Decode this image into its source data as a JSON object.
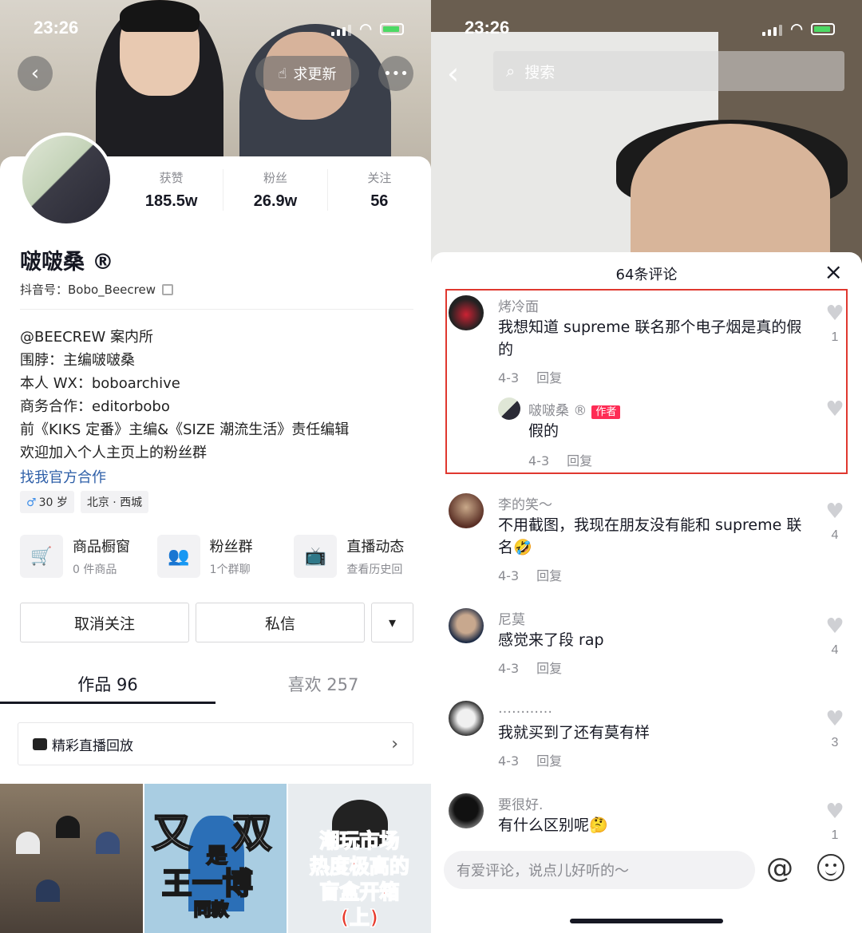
{
  "left": {
    "status": {
      "time": "23:26"
    },
    "header": {
      "request_update_label": "求更新"
    },
    "stats": [
      {
        "label": "获赞",
        "value": "185.5w"
      },
      {
        "label": "粉丝",
        "value": "26.9w"
      },
      {
        "label": "关注",
        "value": "56"
      }
    ],
    "profile": {
      "name": "啵啵桑 ®",
      "id_label": "抖音号：Bobo_Beecrew",
      "bio": [
        "@BEECREW 案内所",
        "围脖：主编啵啵桑",
        "本人 WX：boboarchive",
        "商务合作：editorbobo",
        "前《KIKS 定番》主编&《SIZE 潮流生活》责任编辑",
        "欢迎加入个人主页上的粉丝群"
      ],
      "official_link": "找我官方合作",
      "tags": {
        "age": "30 岁",
        "location": "北京 · 西城",
        "gender_symbol": "♂"
      }
    },
    "services": [
      {
        "title": "商品橱窗",
        "sub": "0 件商品",
        "icon": "cart-icon"
      },
      {
        "title": "粉丝群",
        "sub": "1个群聊",
        "icon": "group-icon"
      },
      {
        "title": "直播动态",
        "sub": "查看历史回",
        "icon": "live-tv-icon"
      }
    ],
    "actions": {
      "unfollow": "取消关注",
      "message": "私信",
      "more": "▾"
    },
    "tabs": [
      {
        "label": "作品 96"
      },
      {
        "label": "喜欢 257"
      }
    ],
    "replay_label": "精彩直播回放",
    "thumbs": {
      "t2_a": "又",
      "t2_b": "双",
      "t2_c": "是",
      "t2_d": "王一博",
      "t2_e": "同款",
      "t3": "潮玩市场\n热度极高的\n盲盒开箱\n(上)"
    }
  },
  "right": {
    "status": {
      "time": "23:26"
    },
    "search_placeholder": "搜索",
    "sheet_title": "64条评论",
    "comments": [
      {
        "user": "烤冷面",
        "text": "我想知道 supreme 联名那个电子烟是真的假的",
        "date": "4-3",
        "reply": "回复",
        "likes": "1"
      },
      {
        "user": "啵啵桑 ®",
        "badge": "作者",
        "text": "假的",
        "date": "4-3",
        "reply": "回复"
      },
      {
        "user": "李的笑～",
        "text": "不用截图，我现在朋友没有能和 supreme 联名🤣",
        "date": "4-3",
        "reply": "回复",
        "likes": "4"
      },
      {
        "user": "尼莫",
        "text": "感觉来了段 rap",
        "date": "4-3",
        "reply": "回复",
        "likes": "4"
      },
      {
        "user": "…………",
        "text": "我就买到了还有莫有样",
        "date": "4-3",
        "reply": "回复",
        "likes": "3"
      },
      {
        "user": "要很好.",
        "text": "有什么区别呢🤔",
        "likes": "1"
      }
    ],
    "composer_placeholder": "有爱评论，说点儿好听的～",
    "colors": {
      "highlight": "#e0382f",
      "author_badge": "#fe2c55"
    }
  }
}
